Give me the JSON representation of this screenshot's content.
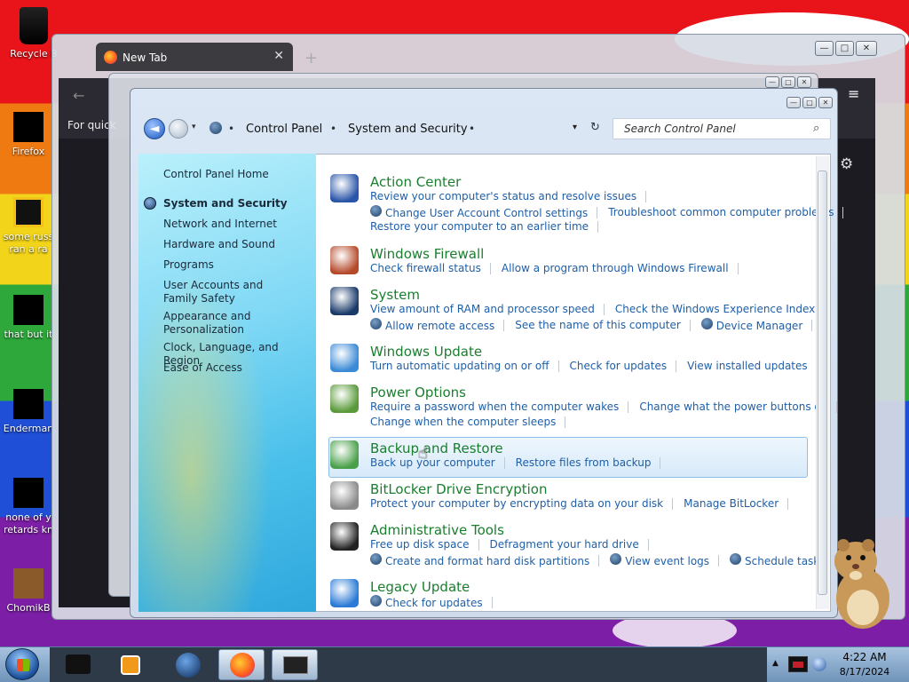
{
  "desktop": {
    "icons": [
      {
        "label": "Recycle B"
      },
      {
        "label": "Firefox"
      },
      {
        "label": "some russ ran a ra"
      },
      {
        "label": "that but it"
      },
      {
        "label": "Enderman"
      },
      {
        "label": "none of y retards kn"
      },
      {
        "label": "ChomikB"
      }
    ]
  },
  "firefox": {
    "tab_title": "New Tab",
    "tab_close": "✕",
    "new_tab": "+",
    "back": "←",
    "quick_text": "For quick",
    "menu": "≡",
    "gear": "⚙"
  },
  "window_controls": {
    "minimize": "—",
    "maximize": "□",
    "close": "✕"
  },
  "control_panel": {
    "back": "◄",
    "recent": "▾",
    "breadcrumbs": [
      "Control Panel",
      "System and Security"
    ],
    "separator": "•",
    "addr_dropdown": "▾",
    "refresh": "↻",
    "search_placeholder": "Search Control Panel",
    "search_icon": "⌕",
    "sidebar": {
      "home": "Control Panel Home",
      "items": [
        "System and Security",
        "Network and Internet",
        "Hardware and Sound",
        "Programs",
        "User Accounts and Family Safety",
        "Appearance and Personalization",
        "Clock, Language, and Region",
        "Ease of Access"
      ]
    },
    "categories": [
      {
        "title": "Action Center",
        "icon": "flag-shield-icon",
        "color": "#2a55a8",
        "rows": [
          [
            "Review your computer's status and resolve issues"
          ],
          [
            "*Change User Account Control settings",
            "Troubleshoot common computer problems"
          ],
          [
            "Restore your computer to an earlier time"
          ]
        ]
      },
      {
        "title": "Windows Firewall",
        "icon": "firewall-icon",
        "color": "#b54a2a",
        "rows": [
          [
            "Check firewall status",
            "Allow a program through Windows Firewall"
          ]
        ]
      },
      {
        "title": "System",
        "icon": "monitor-icon",
        "color": "#1a3a6a",
        "rows": [
          [
            "View amount of RAM and processor speed",
            "Check the Windows Experience Index"
          ],
          [
            "*Allow remote access",
            "See the name of this computer",
            "*Device Manager"
          ]
        ]
      },
      {
        "title": "Windows Update",
        "icon": "windows-update-icon",
        "color": "#3a8ad6",
        "rows": [
          [
            "Turn automatic updating on or off",
            "Check for updates",
            "View installed updates"
          ]
        ]
      },
      {
        "title": "Power Options",
        "icon": "power-plug-icon",
        "color": "#5a9a3a",
        "rows": [
          [
            "Require a password when the computer wakes",
            "Change what the power buttons do"
          ],
          [
            "Change when the computer sleeps"
          ]
        ]
      },
      {
        "title": "Backup and Restore",
        "icon": "backup-icon",
        "color": "#4aa04a",
        "rows": [
          [
            "Back up your computer",
            "Restore files from backup"
          ]
        ]
      },
      {
        "title": "BitLocker Drive Encryption",
        "icon": "bitlocker-icon",
        "color": "#8a8a8a",
        "rows": [
          [
            "Protect your computer by encrypting data on your disk",
            "Manage BitLocker"
          ]
        ]
      },
      {
        "title": "Administrative Tools",
        "icon": "admin-tools-icon",
        "color": "#222222",
        "rows": [
          [
            "Free up disk space",
            "Defragment your hard drive"
          ],
          [
            "*Create and format hard disk partitions",
            "*View event logs",
            "*Schedule tasks"
          ]
        ]
      },
      {
        "title": "Legacy Update",
        "icon": "legacy-update-icon",
        "color": "#2a7ad6",
        "rows": [
          [
            "*Check for updates"
          ]
        ]
      }
    ]
  },
  "taskbar": {
    "tray_up": "▲",
    "time": "4:22 AM",
    "date": "8/17/2024"
  },
  "colors": {
    "link": "#1f5fa8",
    "category_title": "#1a7e2e",
    "taskbar": "#6f93b9"
  }
}
